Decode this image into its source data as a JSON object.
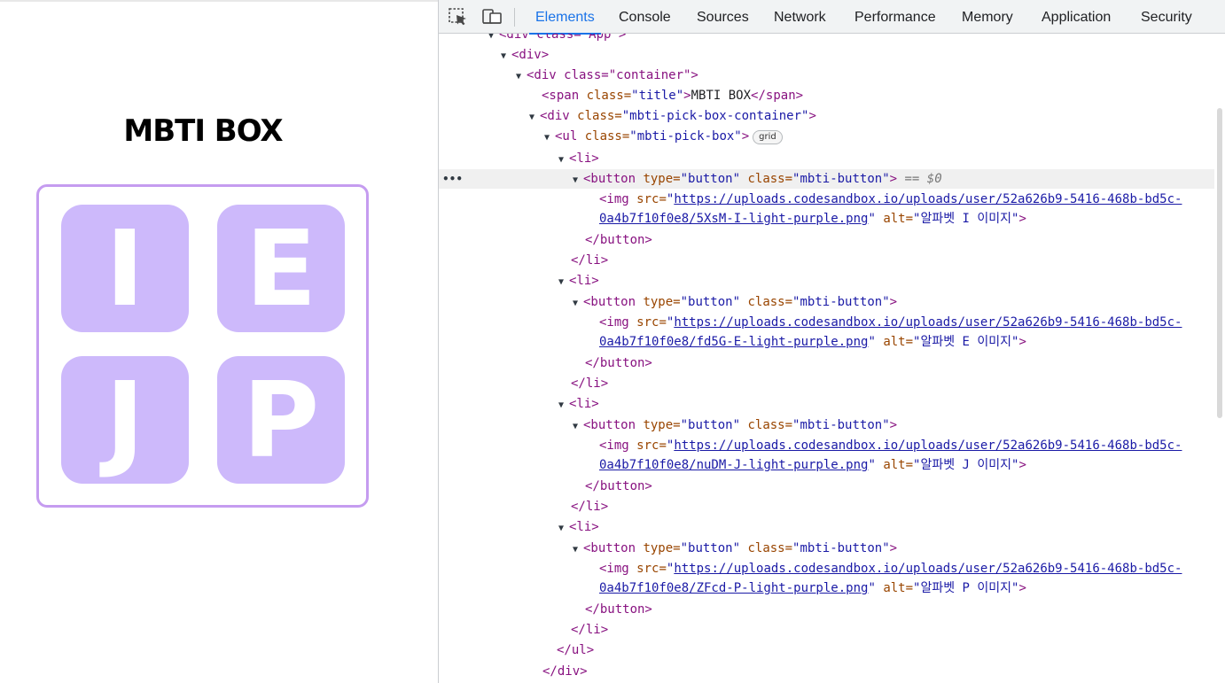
{
  "app": {
    "title": "MBTI BOX",
    "tiles": [
      "I",
      "E",
      "J",
      "P"
    ]
  },
  "devtools": {
    "tabs": [
      "Elements",
      "Console",
      "Sources",
      "Network",
      "Performance",
      "Memory",
      "Application",
      "Security"
    ],
    "active_tab": "Elements",
    "dom": {
      "r0": "<div class=\"App\">",
      "div_open": "<div>",
      "container_open": "<div class=\"container\">",
      "span_tag_open": "<span ",
      "span_attr": "class=",
      "span_val": "\"title\"",
      "span_close_bracket": ">",
      "span_text": "MBTI BOX",
      "span_end": "</span>",
      "pick_container_open": "<div ",
      "pick_container_attr": "class=",
      "pick_container_val": "\"mbti-pick-box-container\"",
      "ul_open": "<ul ",
      "ul_attr": "class=",
      "ul_val": "\"mbti-pick-box\"",
      "ul_close_bracket": ">",
      "grid_badge": "grid",
      "li_open": "<li>",
      "li_close": "</li>",
      "button_open": "<button ",
      "button_attr_type": "type=",
      "button_val_type": "\"button\"",
      "button_attr_class": "class=",
      "button_val_class": "\"mbti-button\"",
      "button_close": "</button>",
      "selected_marker": "== $0",
      "img_open": "<img ",
      "img_attr_src": "src=",
      "img_attr_alt": "alt=",
      "gt": ">",
      "quote": "\"",
      "ul_close": "</ul>",
      "div_close": "</div>",
      "images": [
        {
          "src_line1": "https://uploads.codesandbox.io/uploads/user/52a626b9-5416-468b-bd5c-",
          "src_line2": "0a4b7f10f0e8/5XsM-I-light-purple.png",
          "alt": "\"알파벳 I 이미지\""
        },
        {
          "src_line1": "https://uploads.codesandbox.io/uploads/user/52a626b9-5416-468b-bd5c-",
          "src_line2": "0a4b7f10f0e8/fd5G-E-light-purple.png",
          "alt": "\"알파벳 E 이미지\""
        },
        {
          "src_line1": "https://uploads.codesandbox.io/uploads/user/52a626b9-5416-468b-bd5c-",
          "src_line2": "0a4b7f10f0e8/nuDM-J-light-purple.png",
          "alt": "\"알파벳 J 이미지\""
        },
        {
          "src_line1": "https://uploads.codesandbox.io/uploads/user/52a626b9-5416-468b-bd5c-",
          "src_line2": "0a4b7f10f0e8/ZFcd-P-light-purple.png",
          "alt": "\"알파벳 P 이미지\""
        }
      ]
    }
  }
}
